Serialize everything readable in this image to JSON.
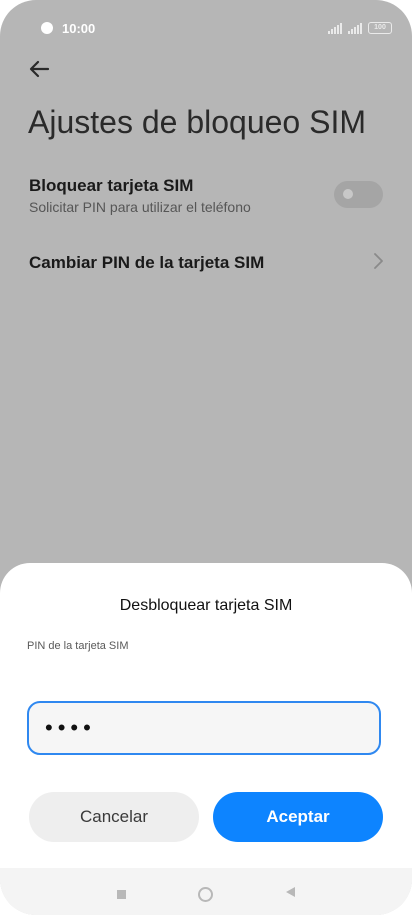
{
  "status_bar": {
    "time": "10:00",
    "battery": "100"
  },
  "header": {
    "title": "Ajustes de bloqueo SIM"
  },
  "settings": {
    "lock_sim": {
      "title": "Bloquear tarjeta SIM",
      "subtitle": "Solicitar PIN para utilizar el teléfono",
      "enabled": false
    },
    "change_pin": {
      "title": "Cambiar PIN de la tarjeta SIM"
    }
  },
  "dialog": {
    "title": "Desbloquear tarjeta SIM",
    "field_label": "PIN de la tarjeta SIM",
    "pin_value": "••••",
    "cancel_label": "Cancelar",
    "accept_label": "Aceptar"
  },
  "icons": {
    "back": "arrow-left-icon",
    "chevron": "chevron-right-icon",
    "nav_recents": "square-icon",
    "nav_home": "circle-icon",
    "nav_back": "triangle-icon"
  },
  "colors": {
    "accent": "#0d84ff",
    "input_border": "#2f88f0",
    "dim_background": "#b6b6b6"
  }
}
